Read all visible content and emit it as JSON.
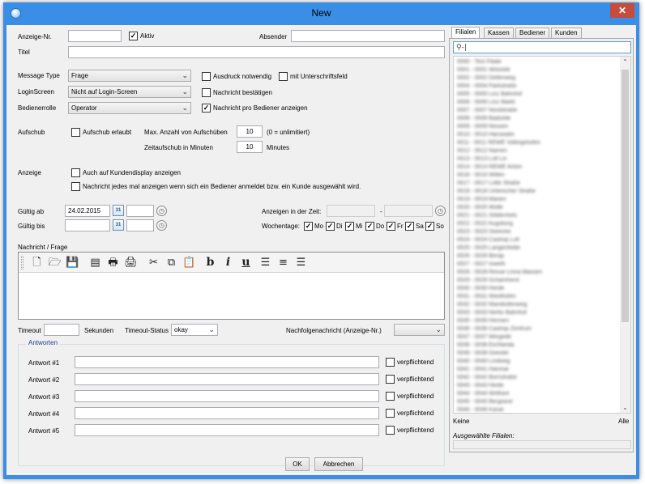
{
  "window": {
    "title": "New",
    "close": "✕"
  },
  "form": {
    "anzeige_nr_label": "Anzeige-Nr.",
    "aktiv_label": "Aktiv",
    "absender_label": "Absender",
    "titel_label": "Titel",
    "message_type_label": "Message Type",
    "message_type_value": "Frage",
    "login_screen_label": "LoginScreen",
    "login_screen_value": "Nicht auf Login-Screen",
    "bedienerrolle_label": "Bedienerrolle",
    "bedienerrolle_value": "Operator",
    "ausdruck_label": "Ausdruck notwendig",
    "unterschrift_label": "mit Unterschriftsfeld",
    "nachricht_bestaetigen_label": "Nachricht bestätigen",
    "pro_bediener_label": "Nachricht pro Bediener anzeigen",
    "aufschub_label": "Aufschub",
    "aufschub_erlaubt_label": "Aufschub erlaubt",
    "max_aufschub_label": "Max. Anzahl von Aufschüben",
    "max_aufschub_value": "10",
    "max_aufschub_hint": "(0 = unlimitiert)",
    "zeitaufschub_label": "Zeitaufschub in Minuten",
    "zeitaufschub_value": "10",
    "zeitaufschub_unit": "Minutes",
    "anzeige_label": "Anzeige",
    "kundendisplay_label": "Auch auf Kundendisplay anzeigen",
    "jedes_mal_label": "Nachricht jedes mal anzeigen wenn sich ein Bediener anmeldet bzw. ein Kunde ausgewählt wird.",
    "gueltig_ab_label": "Gültig ab",
    "gueltig_ab_value": "24.02.2015",
    "gueltig_bis_label": "Gültig bis",
    "anzeigen_zeit_label": "Anzeigen in der Zeit:",
    "zeit_separator": "-",
    "wochentage_label": "Wochentage:",
    "days": [
      "Mo",
      "Di",
      "Mi",
      "Do",
      "Fr",
      "Sa",
      "So"
    ],
    "nachricht_label": "Nachricht / Frage",
    "timeout_label": "Timeout",
    "sekunden_label": "Sekunden",
    "timeout_status_label": "Timeout-Status",
    "timeout_status_value": "okay",
    "nachfolge_label": "Nachfolgenachricht (Anzeige-Nr.)",
    "antworten_title": "Antworten",
    "answers": [
      "Antwort #1",
      "Antwort #2",
      "Antwort #3",
      "Antwort #4",
      "Antwort #5"
    ],
    "verpflichtend_label": "verpflichtend",
    "ok_label": "OK",
    "abbrechen_label": "Abbrechen"
  },
  "toolbar_icons": [
    "new-document-icon",
    "open-folder-icon",
    "save-icon",
    "page-icon",
    "print-icon",
    "print-preview-icon",
    "cut-icon",
    "copy-icon",
    "paste-icon",
    "bold-icon",
    "italic-icon",
    "underline-icon",
    "align-left-icon",
    "align-center-icon",
    "align-right-icon"
  ],
  "toolbar_glyphs": [
    "🗋",
    "🗁",
    "💾",
    "▤",
    "🖶",
    "🖨",
    "✂",
    "⧉",
    "📋",
    "b",
    "i",
    "u",
    "☰",
    "≡",
    "☰"
  ],
  "panel": {
    "tabs": [
      "Filialen",
      "Kassen",
      "Bediener",
      "Kunden"
    ],
    "search_value": "",
    "keine_label": "Keine",
    "alle_label": "Alle",
    "ausgewaehlte_label": "Ausgewählte Filialen:"
  },
  "colors": {
    "title_bar": "#3a8ee6",
    "close_button": "#c74c3c",
    "group_title": "#1e3f8f"
  }
}
